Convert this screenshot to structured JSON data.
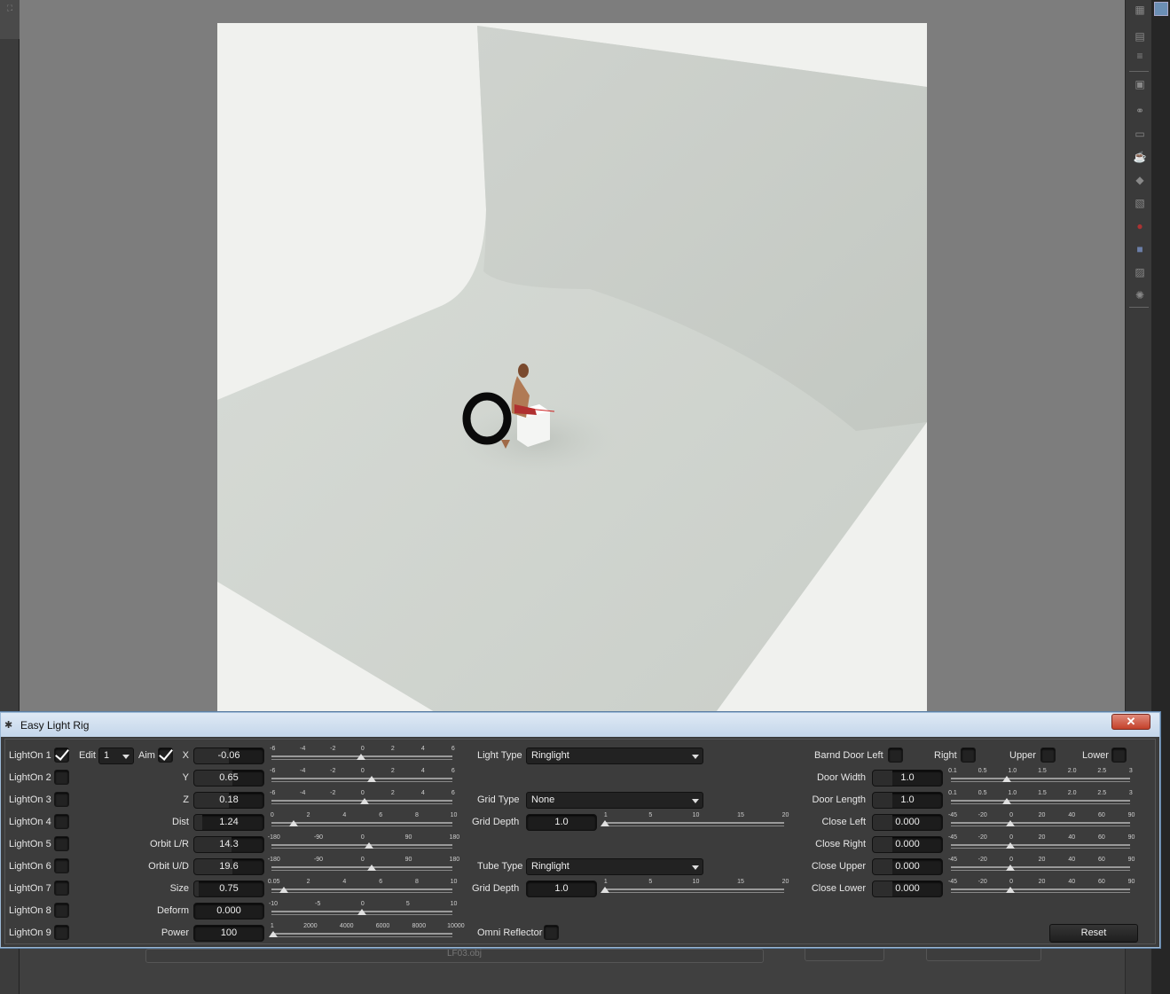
{
  "dialog": {
    "title": "Easy Light Rig",
    "close_label": "✕",
    "lights": [
      "LightOn 1",
      "LightOn 2",
      "LightOn 3",
      "LightOn 4",
      "LightOn 5",
      "LightOn 6",
      "LightOn 7",
      "LightOn 8",
      "LightOn 9"
    ],
    "lights_checked": [
      true,
      false,
      false,
      false,
      false,
      false,
      false,
      false,
      false
    ],
    "edit_label": "Edit",
    "edit_value": "1",
    "aim_label": "Aim",
    "aim_checked": true,
    "params": [
      {
        "label": "X",
        "value": "-0.06",
        "ticks": [
          "-6",
          "-4",
          "-2",
          "0",
          "2",
          "4",
          "6"
        ],
        "fraction": 0.495,
        "fill": 0.5
      },
      {
        "label": "Y",
        "value": "0.65",
        "ticks": [
          "-6",
          "-4",
          "-2",
          "0",
          "2",
          "4",
          "6"
        ],
        "fraction": 0.554,
        "fill": 0.55
      },
      {
        "label": "Z",
        "value": "0.18",
        "ticks": [
          "-6",
          "-4",
          "-2",
          "0",
          "2",
          "4",
          "6"
        ],
        "fraction": 0.515,
        "fill": 0.5
      },
      {
        "label": "Dist",
        "value": "1.24",
        "ticks": [
          "0",
          "2",
          "4",
          "6",
          "8",
          "10"
        ],
        "fraction": 0.124,
        "fill": 0.12
      },
      {
        "label": "Orbit L/R",
        "value": "14.3",
        "ticks": [
          "-180",
          "-90",
          "0",
          "90",
          "180"
        ],
        "fraction": 0.54,
        "fill": 0.54
      },
      {
        "label": "Orbit U/D",
        "value": "19.6",
        "ticks": [
          "-180",
          "-90",
          "0",
          "90",
          "180"
        ],
        "fraction": 0.555,
        "fill": 0.55
      },
      {
        "label": "Size",
        "value": "0.75",
        "ticks": [
          "0.05",
          "2",
          "4",
          "6",
          "8",
          "10"
        ],
        "fraction": 0.07,
        "fill": 0.07
      },
      {
        "label": "Deform",
        "value": "0.000",
        "ticks": [
          "-10",
          "-5",
          "0",
          "5",
          "10"
        ],
        "fraction": 0.5,
        "fill": 0
      },
      {
        "label": "Power",
        "value": "100",
        "ticks": [
          "1",
          "2000",
          "4000",
          "6000",
          "8000",
          "10000"
        ],
        "fraction": 0.01,
        "fill": 0
      }
    ],
    "light_type": {
      "label": "Light Type",
      "value": "Ringlight"
    },
    "grid": {
      "type_label": "Grid  Type",
      "type_value": "None",
      "depth_label": "Grid  Depth",
      "depth_value": "1.0",
      "ticks": [
        "1",
        "5",
        "10",
        "15",
        "20"
      ],
      "fraction": 0.0
    },
    "tube": {
      "type_label": "Tube  Type",
      "type_value": "Ringlight",
      "depth_label": "Grid  Depth",
      "depth_value": "1.0",
      "ticks": [
        "1",
        "5",
        "10",
        "15",
        "20"
      ],
      "fraction": 0.0
    },
    "omni_label": "Omni Reflector",
    "barn_door": {
      "label": "Barnd Door  Left",
      "right_label": "Right",
      "upper_label": "Upper",
      "lower_label": "Lower"
    },
    "door_params": [
      {
        "label": "Door  Width",
        "value": "1.0",
        "ticks": [
          "0.1",
          "0.5",
          "1.0",
          "1.5",
          "2.0",
          "2.5",
          "3"
        ],
        "fraction": 0.31
      },
      {
        "label": "Door Length",
        "value": "1.0",
        "ticks": [
          "0.1",
          "0.5",
          "1.0",
          "1.5",
          "2.0",
          "2.5",
          "3"
        ],
        "fraction": 0.31
      },
      {
        "label": "Close   Left",
        "value": "0.000",
        "ticks": [
          "-45",
          "-20",
          "0",
          "20",
          "40",
          "60",
          "90"
        ],
        "fraction": 0.333
      },
      {
        "label": "Close  Right",
        "value": "0.000",
        "ticks": [
          "-45",
          "-20",
          "0",
          "20",
          "40",
          "60",
          "90"
        ],
        "fraction": 0.333
      },
      {
        "label": "Close Upper",
        "value": "0.000",
        "ticks": [
          "-45",
          "-20",
          "0",
          "20",
          "40",
          "60",
          "90"
        ],
        "fraction": 0.333
      },
      {
        "label": "Close Lower",
        "value": "0.000",
        "ticks": [
          "-45",
          "-20",
          "0",
          "20",
          "40",
          "60",
          "90"
        ],
        "fraction": 0.333
      }
    ],
    "reset_label": "Reset"
  },
  "nodegraph": {
    "node_label": "LF03.obj"
  }
}
